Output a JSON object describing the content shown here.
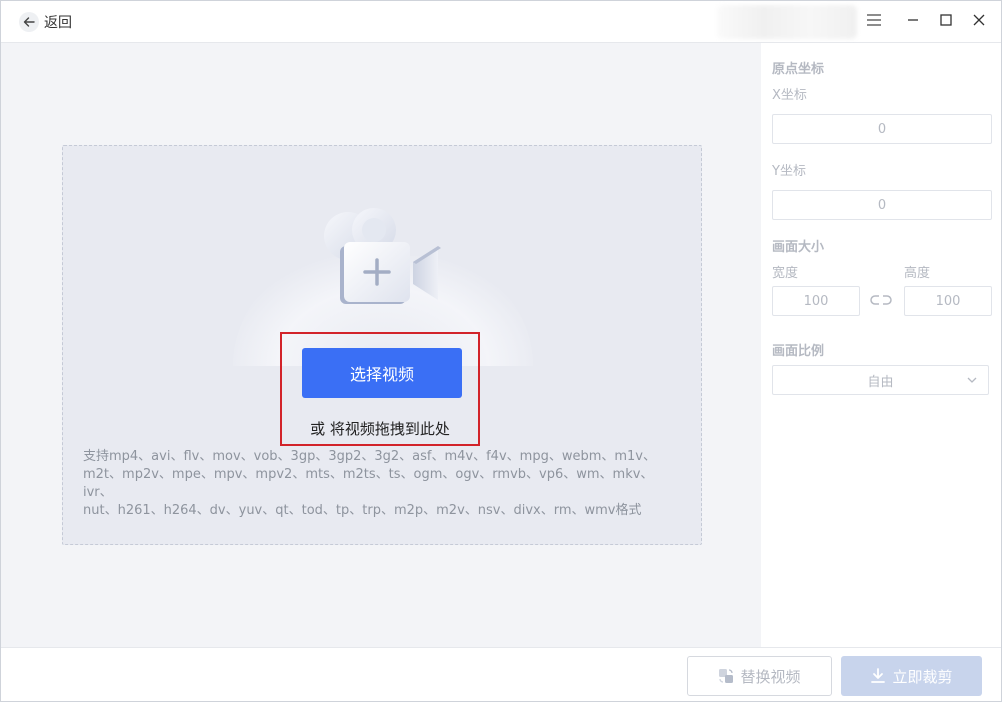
{
  "titlebar": {
    "back_label": "返回"
  },
  "upload": {
    "select_button": "选择视频",
    "drag_hint": "或 将视频拖拽到此处",
    "formats_line1": "支持mp4、avi、flv、mov、vob、3gp、3gp2、3g2、asf、m4v、f4v、mpg、webm、m1v、",
    "formats_line2": "m2t、mp2v、mpe、mpv、mpv2、mts、m2ts、ts、ogm、ogv、rmvb、vp6、wm、mkv、ivr、",
    "formats_line3": "nut、h261、h264、dv、yuv、qt、tod、tp、trp、m2p、m2v、nsv、divx、rm、wmv格式"
  },
  "panel": {
    "origin_title": "原点坐标",
    "x_label": "X坐标",
    "x_value": "0",
    "y_label": "Y坐标",
    "y_value": "0",
    "size_title": "画面大小",
    "width_label": "宽度",
    "width_value": "100",
    "height_label": "高度",
    "height_value": "100",
    "ratio_title": "画面比例",
    "ratio_value": "自由"
  },
  "footer": {
    "replace_label": "替换视频",
    "crop_label": "立即裁剪"
  },
  "colors": {
    "accent": "#3a6ff5",
    "highlight": "#d2232a",
    "disabled_primary": "#c8d4ec"
  }
}
